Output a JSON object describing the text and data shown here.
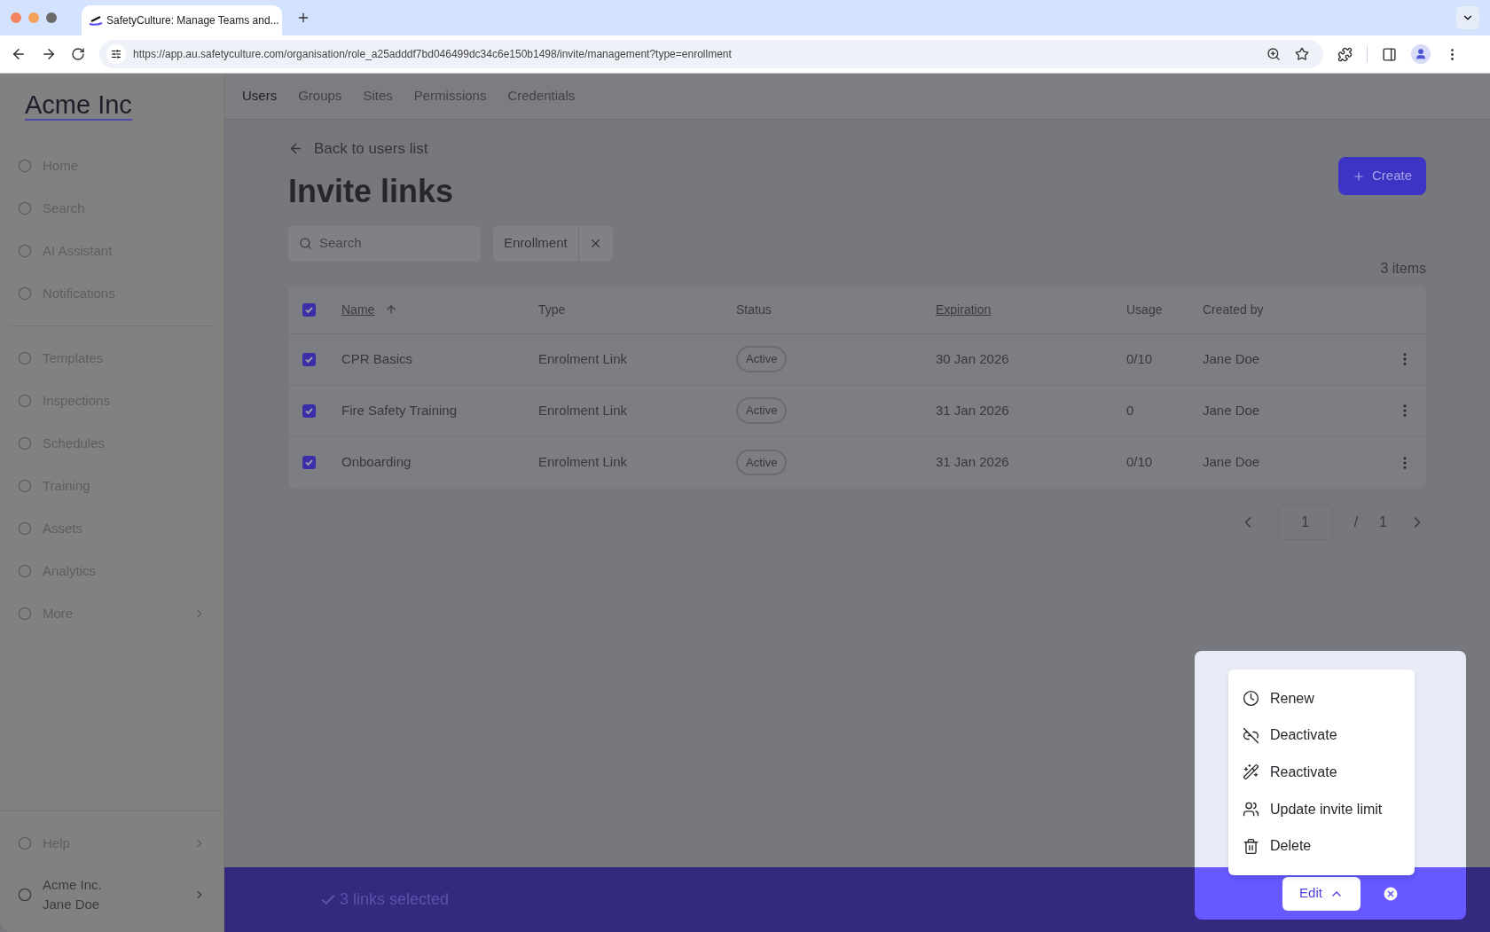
{
  "browser": {
    "tab_title": "SafetyCulture: Manage Teams and...",
    "url": "https://app.au.safetyculture.com/organisation/role_a25adddf7bd046499dc34c6e150b1498/invite/management?type=enrollment"
  },
  "sidebar": {
    "logo": "Acme Inc",
    "top_items": [
      {
        "label": "Home",
        "expandable": false
      },
      {
        "label": "Search",
        "expandable": false
      },
      {
        "label": "AI Assistant",
        "expandable": false
      },
      {
        "label": "Notifications",
        "expandable": false
      }
    ],
    "items": [
      {
        "label": "Templates",
        "expandable": false
      },
      {
        "label": "Inspections",
        "expandable": false
      },
      {
        "label": "Schedules",
        "expandable": false
      },
      {
        "label": "Training",
        "expandable": false
      },
      {
        "label": "Assets",
        "expandable": false
      },
      {
        "label": "Analytics",
        "expandable": false
      },
      {
        "label": "More",
        "expandable": true
      }
    ],
    "help": {
      "label": "Help",
      "expandable": true
    },
    "account": {
      "org": "Acme Inc.",
      "user": "Jane Doe"
    }
  },
  "top_tabs": [
    {
      "label": "Users",
      "selected": true
    },
    {
      "label": "Groups",
      "selected": false
    },
    {
      "label": "Sites",
      "selected": false
    },
    {
      "label": "Permissions",
      "selected": false
    },
    {
      "label": "Credentials",
      "selected": false
    }
  ],
  "back_link": "Back to users list",
  "title": "Invite links",
  "create_button": "Create",
  "search": {
    "placeholder": "Search"
  },
  "filter_chip": "Enrollment",
  "item_count": "3 items",
  "table": {
    "all_checked": true,
    "columns": [
      {
        "label": "Name",
        "sortable": true,
        "sorted": true
      },
      {
        "label": "Type",
        "sortable": false,
        "sorted": false
      },
      {
        "label": "Status",
        "sortable": false,
        "sorted": false
      },
      {
        "label": "Expiration",
        "sortable": true,
        "sorted": false
      },
      {
        "label": "Usage",
        "sortable": false,
        "sorted": false
      },
      {
        "label": "Created by",
        "sortable": false,
        "sorted": false
      }
    ],
    "rows": [
      {
        "checked": true,
        "name": "CPR Basics",
        "type": "Enrolment Link",
        "status": "Active",
        "expiration": "30 Jan 2026",
        "usage": "0/10",
        "created_by": "Jane Doe"
      },
      {
        "checked": true,
        "name": "Fire Safety Training",
        "type": "Enrolment Link",
        "status": "Active",
        "expiration": "31 Jan 2026",
        "usage": "0",
        "created_by": "Jane Doe"
      },
      {
        "checked": true,
        "name": "Onboarding",
        "type": "Enrolment Link",
        "status": "Active",
        "expiration": "31 Jan 2026",
        "usage": "0/10",
        "created_by": "Jane Doe"
      }
    ]
  },
  "pagination": {
    "page": "1",
    "separator": "/",
    "total": "1"
  },
  "selection_bar": {
    "text": "3 links selected"
  },
  "edit_menu": {
    "button": "Edit",
    "expanded": true,
    "items": [
      {
        "label": "Renew"
      },
      {
        "label": "Deactivate"
      },
      {
        "label": "Reactivate"
      },
      {
        "label": "Update invite limit"
      },
      {
        "label": "Delete"
      }
    ]
  }
}
